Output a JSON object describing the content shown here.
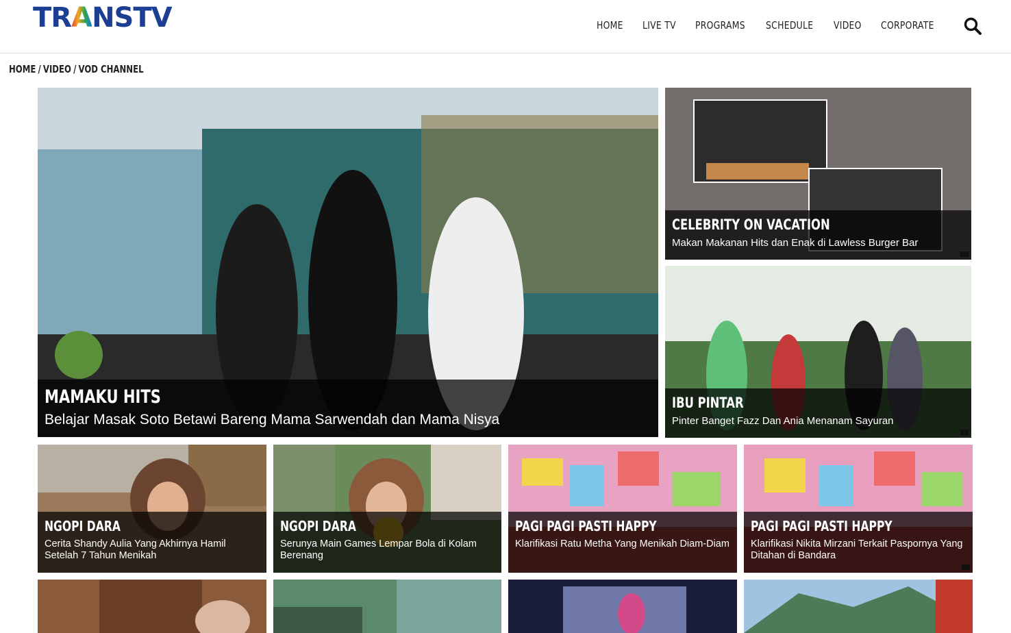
{
  "header": {
    "logo_text_pre": "TR",
    "logo_text_a": "A",
    "logo_text_post": "NSTV",
    "nav": [
      "HOME",
      "LIVE TV",
      "PROGRAMS",
      "SCHEDULE",
      "VIDEO",
      "CORPORATE"
    ],
    "search_icon": "search-icon"
  },
  "breadcrumb": {
    "items": [
      "HOME",
      "VIDEO",
      "VOD CHANNEL"
    ],
    "separator": "/"
  },
  "featured": {
    "program": "MAMAKU HITS",
    "title": "Belajar Masak Soto Betawi Bareng Mama Sarwendah dan Mama Nisya"
  },
  "side": [
    {
      "program": "CELEBRITY ON VACATION",
      "title": "Makan Makanan Hits dan Enak di Lawless Burger Bar"
    },
    {
      "program": "IBU PINTAR",
      "title": "Pinter Banget Fazz Dan Ania Menanam Sayuran"
    }
  ],
  "grid": [
    {
      "program": "NGOPI DARA",
      "title": "Cerita Shandy Aulia Yang Akhirnya Hamil Setelah 7 Tahun Menikah"
    },
    {
      "program": "NGOPI DARA",
      "title": "Serunya Main Games Lempar Bola di Kolam Berenang"
    },
    {
      "program": "PAGI PAGI PASTI HAPPY",
      "title": "Klarifikasi Ratu Metha Yang Menikah Diam-Diam"
    },
    {
      "program": "PAGI PAGI PASTI HAPPY",
      "title": "Klarifikasi Nikita Mirzani Terkait Paspornya Yang Ditahan di Bandara"
    }
  ],
  "colors": {
    "brand_blue": "#1c3f94",
    "caption_bg": "rgba(0,0,0,0.72)"
  }
}
